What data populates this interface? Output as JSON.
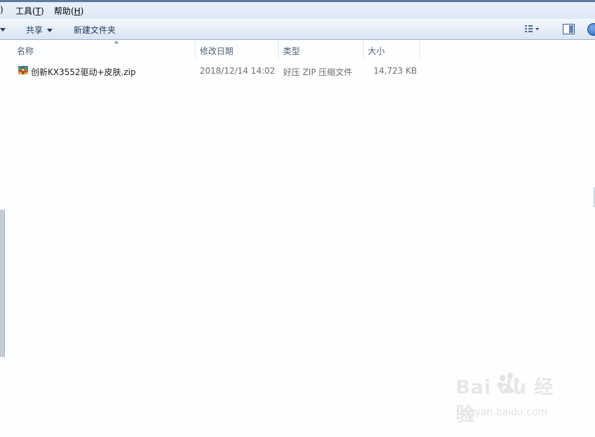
{
  "menu": {
    "partial_item": ")",
    "tools": {
      "label": "工具(",
      "accel": "T",
      "close": ")"
    },
    "help": {
      "label": "帮助(",
      "accel": "H",
      "close": ")"
    }
  },
  "toolbar": {
    "share_label": "共享",
    "new_folder_label": "新建文件夹",
    "view_icon": "views-icon",
    "preview_icon": "preview-pane-icon",
    "help_icon": "help-icon"
  },
  "columns": {
    "name": "名称",
    "modified": "修改日期",
    "type": "类型",
    "size": "大小"
  },
  "files": [
    {
      "name": "创新KX3552驱动+皮肤.zip",
      "modified": "2018/12/14 14:02",
      "type": "好压 ZIP 压缩文件",
      "size": "14,723 KB",
      "icon": "zip-archive-icon"
    }
  ],
  "watermark": {
    "logo": "Bai  du 经验",
    "url": "jingyan.baidu.com"
  },
  "colors": {
    "accent": "#1e395b",
    "header_text": "#4c607a",
    "background": "#fdfeff"
  }
}
